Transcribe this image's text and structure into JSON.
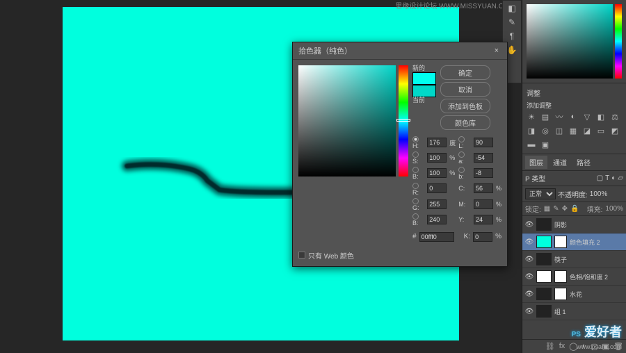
{
  "watermark_top": "思缘设计论坛 WWW.MISSYUAN.COM",
  "watermark_logo": "PS 爱好者",
  "watermark_url": "www.psahz.com",
  "dialog": {
    "title": "拾色器（纯色）",
    "close": "×",
    "new_label": "新的",
    "current_label": "当前",
    "ok": "确定",
    "cancel": "取消",
    "add_swatch": "添加到色板",
    "libraries": "颜色库",
    "web_only": "只有 Web 颜色",
    "hex_prefix": "#",
    "hex": "00fff0",
    "fields": {
      "H": {
        "v": "176",
        "u": "度"
      },
      "S": {
        "v": "100",
        "u": "%"
      },
      "B": {
        "v": "100",
        "u": "%"
      },
      "R": {
        "v": "0",
        "u": ""
      },
      "G": {
        "v": "255",
        "u": ""
      },
      "Bb": {
        "v": "240",
        "u": ""
      },
      "L": {
        "v": "90",
        "u": ""
      },
      "a": {
        "v": "-54",
        "u": ""
      },
      "b2": {
        "v": "-8",
        "u": ""
      },
      "C": {
        "v": "56",
        "u": "%"
      },
      "M": {
        "v": "0",
        "u": "%"
      },
      "Y": {
        "v": "24",
        "u": "%"
      },
      "K": {
        "v": "0",
        "u": "%"
      }
    }
  },
  "adjustments": {
    "title": "调整",
    "add": "添加调整"
  },
  "layers": {
    "tabs": [
      "图层",
      "通道",
      "路径"
    ],
    "kind": "P 类型",
    "blend": "正常",
    "opacity_lbl": "不透明度:",
    "opacity": "100%",
    "lock": "锁定:",
    "fill_lbl": "填充:",
    "fill": "100%",
    "items": [
      {
        "name": "阴影",
        "thumb": "dark"
      },
      {
        "name": "颜色填充 2",
        "thumb": "cyan",
        "sel": true,
        "mask": true
      },
      {
        "name": "筷子",
        "thumb": "dark"
      },
      {
        "name": "色相/饱和度 2",
        "thumb": "white",
        "mask": true
      },
      {
        "name": "水花",
        "thumb": "dark",
        "mask": true
      },
      {
        "name": "组 1",
        "thumb": "dark"
      }
    ]
  }
}
